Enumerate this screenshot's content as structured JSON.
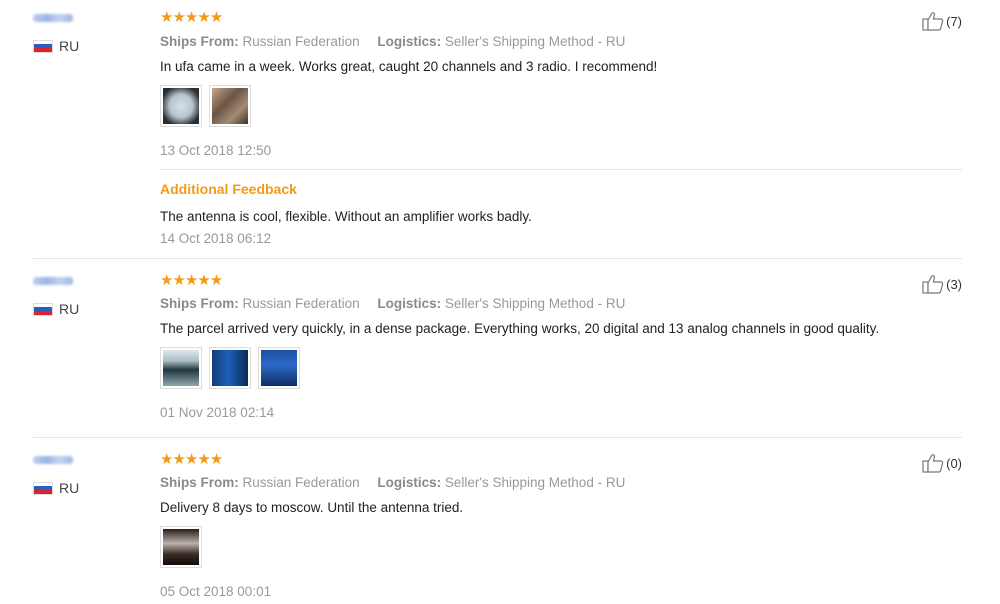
{
  "reviews": [
    {
      "country": "RU",
      "stars": "★★★★★",
      "ships_label": "Ships From:",
      "ships_value": "Russian Federation",
      "logistics_label": "Logistics:",
      "logistics_value": "Seller's Shipping Method - RU",
      "text": "In ufa came in a week. Works great, caught 20 channels and 3 radio. I recommend!",
      "date": "13 Oct 2018 12:50",
      "likes": "(7)",
      "additional": {
        "label": "Additional Feedback",
        "text": "The antenna is cool, flexible. Without an amplifier works badly.",
        "date": "14 Oct 2018 06:12"
      }
    },
    {
      "country": "RU",
      "stars": "★★★★★",
      "ships_label": "Ships From:",
      "ships_value": "Russian Federation",
      "logistics_label": "Logistics:",
      "logistics_value": "Seller's Shipping Method - RU",
      "text": "The parcel arrived very quickly, in a dense package. Everything works, 20 digital and 13 analog channels in good quality.",
      "date": "01 Nov 2018 02:14",
      "likes": "(3)"
    },
    {
      "country": "RU",
      "stars": "★★★★★",
      "ships_label": "Ships From:",
      "ships_value": "Russian Federation",
      "logistics_label": "Logistics:",
      "logistics_value": "Seller's Shipping Method - RU",
      "text": "Delivery 8 days to moscow. Until the antenna tried.",
      "date": "05 Oct 2018 00:01",
      "likes": "(0)"
    }
  ],
  "colors": {
    "accent": "#f39a16",
    "muted": "#999999"
  },
  "icons": {
    "star": "star-icon",
    "like": "thumbs-up-icon",
    "flag": "flag-ru-icon"
  }
}
